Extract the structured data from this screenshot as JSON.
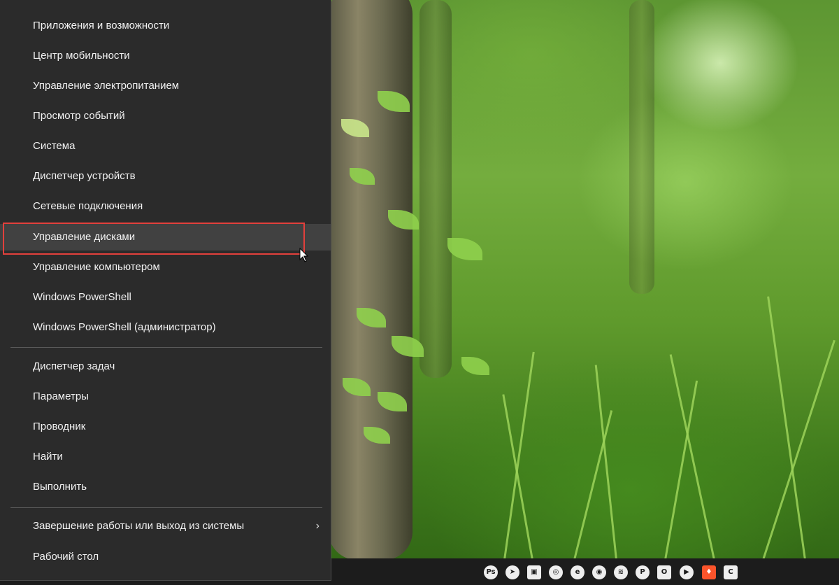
{
  "menu": {
    "group1": [
      {
        "label": "Приложения и возможности"
      },
      {
        "label": "Центр мобильности"
      },
      {
        "label": "Управление электропитанием"
      },
      {
        "label": "Просмотр событий"
      },
      {
        "label": "Система"
      },
      {
        "label": "Диспетчер устройств"
      },
      {
        "label": "Сетевые подключения"
      },
      {
        "label": "Управление дисками"
      },
      {
        "label": "Управление компьютером"
      },
      {
        "label": "Windows PowerShell"
      },
      {
        "label": "Windows PowerShell (администратор)"
      }
    ],
    "group2": [
      {
        "label": "Диспетчер задач"
      },
      {
        "label": "Параметры"
      },
      {
        "label": "Проводник"
      },
      {
        "label": "Найти"
      },
      {
        "label": "Выполнить"
      }
    ],
    "group3": [
      {
        "label": "Завершение работы или выход из системы",
        "submenu_arrow": "›"
      },
      {
        "label": "Рабочий стол"
      }
    ],
    "hovered_item": "Управление дисками"
  },
  "colors": {
    "menu_background": "#2b2b2b",
    "hover_background": "#414141",
    "highlight_border": "#e2403c",
    "taskbar": "#1c1c1c"
  },
  "taskbar": {
    "tray_icons": [
      {
        "name": "photoshop-icon",
        "glyph": "Ps"
      },
      {
        "name": "telegram-icon",
        "glyph": "➤"
      },
      {
        "name": "image-viewer-icon",
        "glyph": "▣"
      },
      {
        "name": "chrome-icon",
        "glyph": "◎"
      },
      {
        "name": "edge-icon",
        "glyph": "e"
      },
      {
        "name": "camera-icon",
        "glyph": "◉"
      },
      {
        "name": "layers-icon",
        "glyph": "≋"
      },
      {
        "name": "p-app-icon",
        "glyph": "P"
      },
      {
        "name": "opera-icon",
        "glyph": "O"
      },
      {
        "name": "media-player-icon",
        "glyph": "▶"
      },
      {
        "name": "brave-icon",
        "glyph": "♦"
      },
      {
        "name": "c-app-icon",
        "glyph": "C"
      }
    ]
  }
}
